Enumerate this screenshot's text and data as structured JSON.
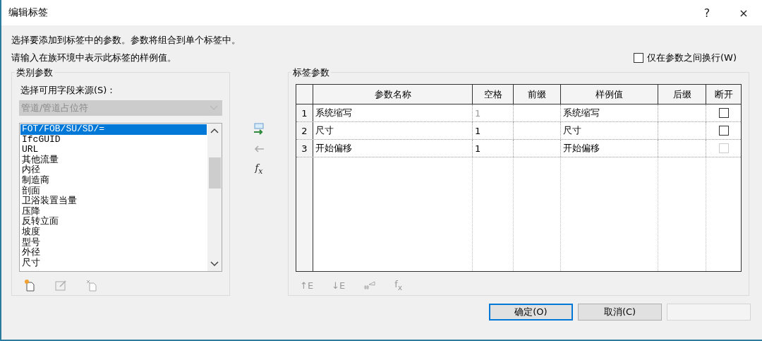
{
  "window": {
    "title": "编辑标签",
    "help": "?",
    "close": "×"
  },
  "instructions": [
    "选择要添加到标签中的参数。参数将组合到单个标签中。",
    "请输入在族环境中表示此标签的样例值。"
  ],
  "wrap_option": {
    "label": "仅在参数之间换行(W)",
    "checked": false
  },
  "category_parameters": {
    "title": "类别参数",
    "source_label": "选择可用字段来源(S)：",
    "source_value": "管道/管道占位符",
    "source_disabled": true,
    "items": [
      {
        "label": "FOT/FOB/SU/SD/=",
        "selected": true
      },
      {
        "label": "IfcGUID",
        "selected": false
      },
      {
        "label": "URL",
        "selected": false
      },
      {
        "label": "其他流量",
        "selected": false
      },
      {
        "label": "内径",
        "selected": false
      },
      {
        "label": "制造商",
        "selected": false
      },
      {
        "label": "剖面",
        "selected": false
      },
      {
        "label": "卫浴装置当量",
        "selected": false
      },
      {
        "label": "压降",
        "selected": false
      },
      {
        "label": "反转立面",
        "selected": false
      },
      {
        "label": "坡度",
        "selected": false
      },
      {
        "label": "型号",
        "selected": false
      },
      {
        "label": "外径",
        "selected": false
      },
      {
        "label": "尺寸",
        "selected": false
      }
    ]
  },
  "transfer_buttons": {
    "formula": "f$_{x}$"
  },
  "label_parameters": {
    "title": "标签参数",
    "columns": [
      "参数名称",
      "空格",
      "前缀",
      "样例值",
      "后缀",
      "断开"
    ],
    "rows": [
      {
        "number": "1",
        "name": "系统缩写",
        "spaces": "1",
        "spaces_disabled": true,
        "prefix": "",
        "sample": "系统缩写",
        "suffix": "",
        "break": false,
        "break_disabled": false
      },
      {
        "number": "2",
        "name": "尺寸",
        "spaces": "1",
        "spaces_disabled": false,
        "prefix": "",
        "sample": "尺寸",
        "suffix": "",
        "break": false,
        "break_disabled": false
      },
      {
        "number": "3",
        "name": "开始偏移",
        "spaces": "1",
        "spaces_disabled": false,
        "prefix": "",
        "sample": "开始偏移",
        "suffix": "",
        "break": false,
        "break_disabled": true
      }
    ],
    "toolbar": [
      {
        "kind": "text",
        "label": "↑E"
      },
      {
        "kind": "text",
        "label": "↓E"
      },
      {
        "kind": "icon"
      },
      {
        "kind": "text",
        "label": "f$_{x}$"
      }
    ]
  },
  "buttons": [
    {
      "label": "确定(O)",
      "default": true,
      "disabled": false
    },
    {
      "label": "取消(C)",
      "default": false,
      "disabled": false
    },
    {
      "default": false,
      "disabled": true
    }
  ]
}
